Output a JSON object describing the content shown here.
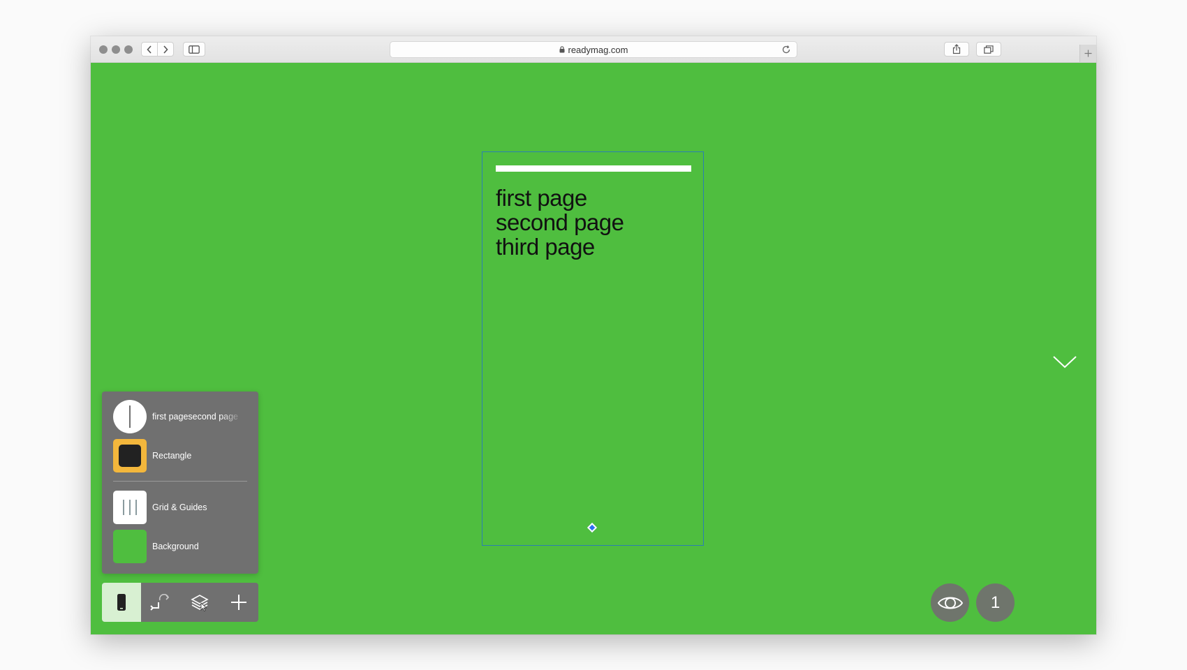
{
  "browser": {
    "url": "readymag.com"
  },
  "page": {
    "text_lines": [
      "first page",
      "second page",
      "third page"
    ]
  },
  "layers": {
    "items": [
      {
        "label": "first pagesecond page",
        "icon": "text-layer-icon"
      },
      {
        "label": "Rectangle",
        "icon": "rectangle-layer-icon"
      },
      {
        "label": "Grid & Guides",
        "icon": "grid-guides-icon"
      },
      {
        "label": "Background",
        "icon": "background-layer-icon"
      }
    ]
  },
  "toolbar": {
    "tools": [
      "mobile-view-icon",
      "links-icon",
      "layers-icon",
      "add-icon"
    ]
  },
  "controls": {
    "preview_icon": "eye-icon",
    "page_number": "1"
  },
  "colors": {
    "canvas_bg": "#4fbe3f",
    "panel_bg": "#707070",
    "rectangle_selected": "#f3b73c",
    "selection_frame": "#2a7fb3",
    "handle": "#2b6ff2"
  }
}
